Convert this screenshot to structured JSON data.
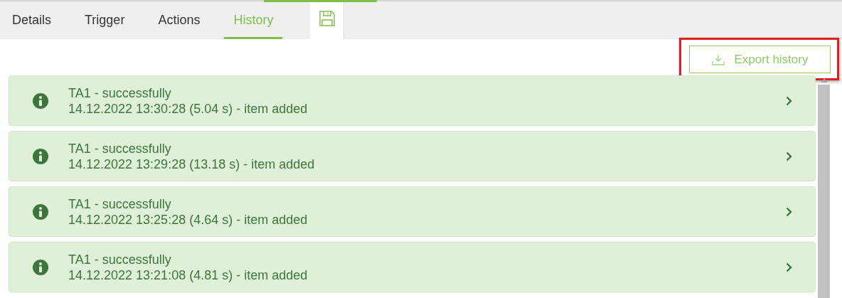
{
  "tabs": [
    {
      "label": "Details",
      "selected": false
    },
    {
      "label": "Trigger",
      "selected": false
    },
    {
      "label": "Actions",
      "selected": false
    },
    {
      "label": "History",
      "selected": true
    }
  ],
  "export_button": {
    "label": "Export history",
    "highlighted": true
  },
  "history": [
    {
      "title": "TA1 - successfully",
      "detail": "14.12.2022 13:30:28 (5.04 s) - item added"
    },
    {
      "title": "TA1 - successfully",
      "detail": "14.12.2022 13:29:28 (13.18 s) - item added"
    },
    {
      "title": "TA1 - successfully",
      "detail": "14.12.2022 13:25:28 (4.64 s) - item added"
    },
    {
      "title": "TA1 - successfully",
      "detail": "14.12.2022 13:21:08 (4.81 s) - item added"
    }
  ]
}
